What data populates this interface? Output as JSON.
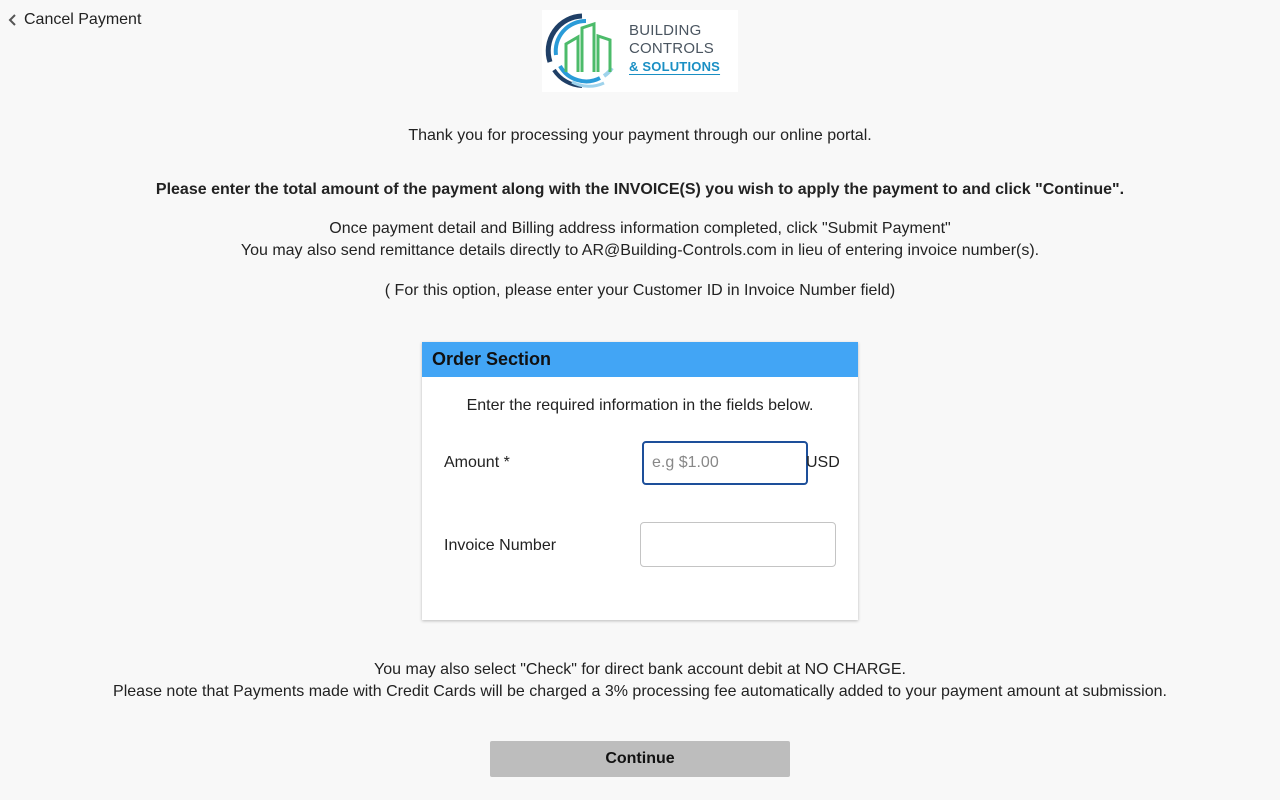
{
  "header": {
    "cancel_label": "Cancel Payment",
    "logo": {
      "line1": "BUILDING",
      "line2": "CONTROLS",
      "line3": "& SOLUTIONS",
      "colors": {
        "arc_dark": "#1f3f66",
        "arc_blue": "#2a9bd8",
        "arc_light": "#9fd3ec",
        "buildings": "#4cbb6a",
        "text": "#4a5560",
        "accent": "#1a8fc4"
      }
    }
  },
  "intro": {
    "thanks": "Thank you for processing your payment through our online portal.",
    "instructions": "Please enter the total amount of the payment along with the INVOICE(S) you wish to apply the payment to and click \"Continue\".",
    "detail_line1": "Once payment detail and Billing address information completed, click \"Submit Payment\"",
    "detail_line2": "You may also send remittance details directly to AR@Building-Controls.com in lieu of entering invoice number(s).",
    "option_note": "( For this option, please enter your Customer ID in Invoice Number field)"
  },
  "order": {
    "title": "Order Section",
    "intro": "Enter the required information in the fields below.",
    "amount_label": "Amount *",
    "amount_placeholder": "e.g $1.00",
    "amount_value": "",
    "currency": "USD",
    "invoice_label": "Invoice Number",
    "invoice_value": "",
    "header_color": "#42a5f5"
  },
  "footer": {
    "line1": "You may also select \"Check\" for direct bank account debit at NO CHARGE.",
    "line2": "Please note that Payments made with Credit Cards will be charged a 3% processing fee automatically added to your payment amount at submission.",
    "continue_label": "Continue"
  }
}
